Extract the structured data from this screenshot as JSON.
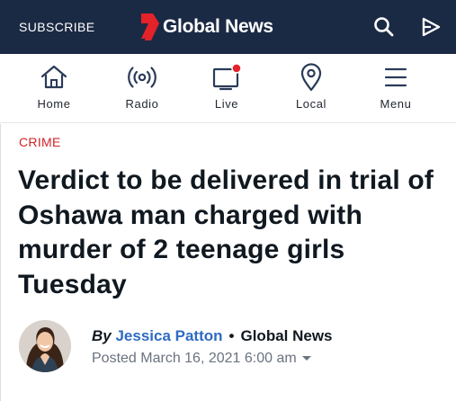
{
  "header": {
    "subscribe_label": "SUBSCRIBE",
    "brand_name": "Global News",
    "brand_color": "#e4222a",
    "background_color": "#1b2a44"
  },
  "nav": {
    "items": [
      {
        "label": "Home",
        "icon": "home-icon"
      },
      {
        "label": "Radio",
        "icon": "radio-icon"
      },
      {
        "label": "Live",
        "icon": "live-tv-icon"
      },
      {
        "label": "Local",
        "icon": "location-pin-icon"
      },
      {
        "label": "Menu",
        "icon": "menu-icon"
      }
    ],
    "icon_color": "#2a3b59",
    "live_dot_color": "#e4222a"
  },
  "article": {
    "category": "CRIME",
    "headline": "Verdict to be delivered in trial of Oshawa man charged with murder of 2 teenage girls Tuesday",
    "byline_by": "By",
    "author": "Jessica Patton",
    "separator": "•",
    "outlet": "Global News",
    "posted": "Posted March 16, 2021 6:00 am"
  }
}
